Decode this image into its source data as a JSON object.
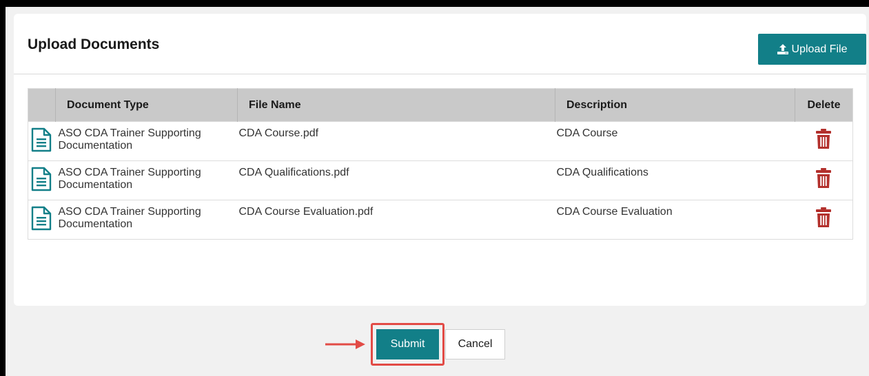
{
  "dialog": {
    "title": "Upload Documents",
    "upload_button_label": "Upload File"
  },
  "table": {
    "headers": {
      "document_type": "Document Type",
      "file_name": "File Name",
      "description": "Description",
      "delete": "Delete"
    },
    "rows": [
      {
        "document_type_line1": "ASO CDA Trainer Supporting",
        "document_type_line2": "Documentation",
        "file_name": "CDA Course.pdf",
        "description": "CDA Course"
      },
      {
        "document_type_line1": "ASO CDA Trainer Supporting",
        "document_type_line2": "Documentation",
        "file_name": "CDA Qualifications.pdf",
        "description": "CDA Qualifications"
      },
      {
        "document_type_line1": "ASO CDA Trainer Supporting",
        "document_type_line2": "Documentation",
        "file_name": "CDA Course Evaluation.pdf",
        "description": "CDA Course Evaluation"
      }
    ]
  },
  "actions": {
    "submit_label": "Submit",
    "cancel_label": "Cancel"
  },
  "icons": {
    "upload": "upload-icon",
    "document": "document-icon",
    "delete": "trash-icon",
    "callout": "arrow-right-icon"
  },
  "colors": {
    "primary": "#127f88",
    "delete": "#b3302c",
    "highlight": "#e24b46",
    "header_bg": "#c9c9c9"
  }
}
